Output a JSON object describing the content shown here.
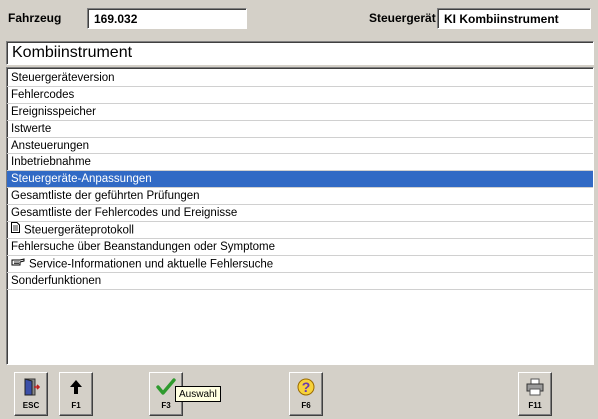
{
  "header": {
    "vehicle_label": "Fahrzeug",
    "vehicle_value": "169.032",
    "ecu_label": "Steuergerät",
    "ecu_value": "KI Kombiinstrument"
  },
  "subtitle": "Kombiinstrument",
  "menu": {
    "items": [
      {
        "label": "Steuergeräteversion"
      },
      {
        "label": "Fehlercodes"
      },
      {
        "label": "Ereignisspeicher"
      },
      {
        "label": "Istwerte"
      },
      {
        "label": "Ansteuerungen"
      },
      {
        "label": "Inbetriebnahme"
      },
      {
        "label": "Steuergeräte-Anpassungen",
        "selected": true
      },
      {
        "label": "Gesamtliste der geführten Prüfungen"
      },
      {
        "label": "Gesamtliste der Fehlercodes und Ereignisse"
      },
      {
        "label": "Steuergeräteprotokoll",
        "icon": "document-icon"
      },
      {
        "label": "Fehlersuche über Beanstandungen oder Symptome"
      },
      {
        "label": "Service-Informationen und aktuelle Fehlersuche",
        "icon": "pointing-hand-icon"
      },
      {
        "label": "Sonderfunktionen"
      }
    ]
  },
  "toolbar": {
    "esc": {
      "key": "ESC",
      "icon": "exit-door-icon"
    },
    "f1": {
      "key": "F1",
      "icon": "arrow-up-icon"
    },
    "f3": {
      "key": "F3",
      "icon": "checkmark-icon"
    },
    "f6": {
      "key": "F6",
      "icon": "help-question-icon"
    },
    "f11": {
      "key": "F11",
      "icon": "printer-icon"
    }
  },
  "tooltip": "Auswahl",
  "colors": {
    "selection": "#316ac5",
    "background": "#d4d0c8",
    "checkmark": "#2e9a2e",
    "help": "#e8b400"
  }
}
